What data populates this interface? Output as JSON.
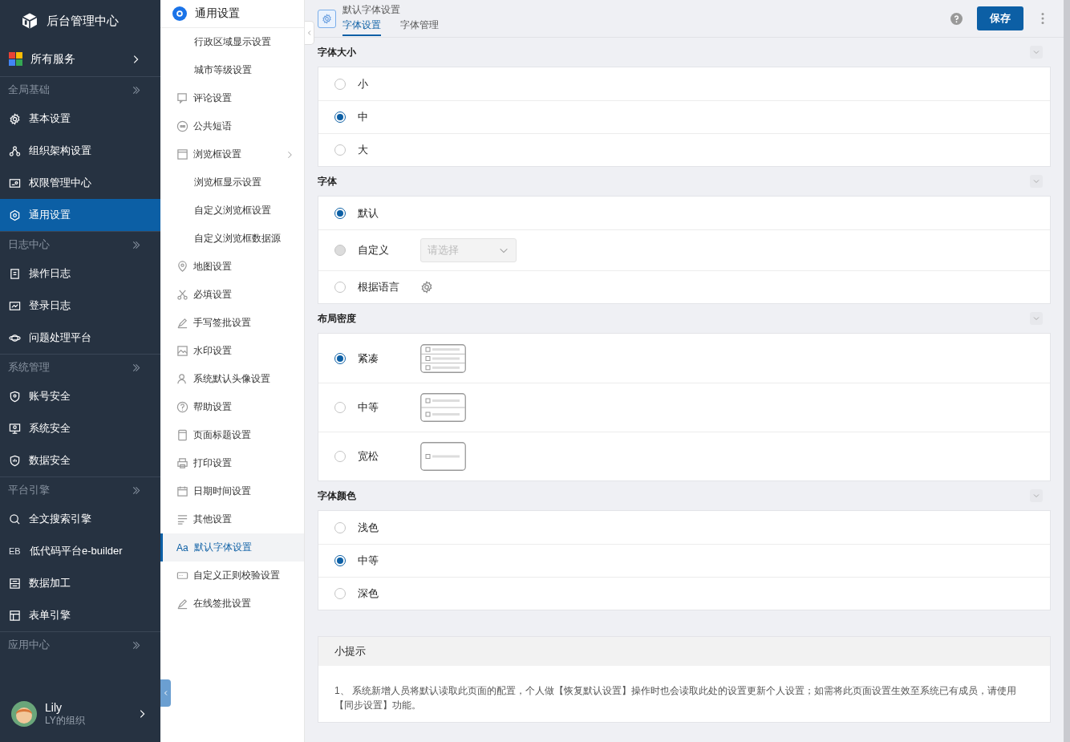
{
  "app": {
    "title": "后台管理中心"
  },
  "all_services": {
    "label": "所有服务"
  },
  "sidebar": {
    "groups": [
      {
        "label": "全局基础",
        "items": [
          {
            "label": "基本设置",
            "selected": false
          },
          {
            "label": "组织架构设置",
            "selected": false
          },
          {
            "label": "权限管理中心",
            "selected": false
          },
          {
            "label": "通用设置",
            "selected": true
          }
        ]
      },
      {
        "label": "日志中心",
        "items": [
          {
            "label": "操作日志",
            "selected": false
          },
          {
            "label": "登录日志",
            "selected": false
          },
          {
            "label": "问题处理平台",
            "selected": false
          }
        ]
      },
      {
        "label": "系统管理",
        "items": [
          {
            "label": "账号安全",
            "selected": false
          },
          {
            "label": "系统安全",
            "selected": false
          },
          {
            "label": "数据安全",
            "selected": false
          }
        ]
      },
      {
        "label": "平台引擎",
        "items": [
          {
            "label": "全文搜索引擎",
            "selected": false
          },
          {
            "label": "低代码平台e-builder",
            "selected": false,
            "badge": "EB"
          },
          {
            "label": "数据加工",
            "selected": false
          },
          {
            "label": "表单引擎",
            "selected": false
          }
        ]
      },
      {
        "label": "应用中心"
      }
    ]
  },
  "user": {
    "name": "Lily",
    "org": "LY的组织"
  },
  "submenu": {
    "title": "通用设置",
    "items": [
      {
        "label": "行政区域显示设置",
        "kind": "sub",
        "selected": false
      },
      {
        "label": "城市等级设置",
        "kind": "sub",
        "selected": false
      },
      {
        "label": "评论设置",
        "kind": "entry",
        "selected": false
      },
      {
        "label": "公共短语",
        "kind": "entry",
        "selected": false
      },
      {
        "label": "浏览框设置",
        "kind": "entry",
        "selected": false,
        "children": [
          {
            "label": "浏览框显示设置",
            "kind": "sub",
            "selected": false
          },
          {
            "label": "自定义浏览框设置",
            "kind": "sub",
            "selected": false
          },
          {
            "label": "自定义浏览框数据源",
            "kind": "sub",
            "selected": false
          }
        ]
      },
      {
        "label": "地图设置",
        "kind": "entry",
        "selected": false
      },
      {
        "label": "必填设置",
        "kind": "entry",
        "selected": false
      },
      {
        "label": "手写签批设置",
        "kind": "entry",
        "selected": false
      },
      {
        "label": "水印设置",
        "kind": "entry",
        "selected": false
      },
      {
        "label": "系统默认头像设置",
        "kind": "entry",
        "selected": false
      },
      {
        "label": "帮助设置",
        "kind": "entry",
        "selected": false
      },
      {
        "label": "页面标题设置",
        "kind": "entry",
        "selected": false
      },
      {
        "label": "打印设置",
        "kind": "entry",
        "selected": false
      },
      {
        "label": "日期时间设置",
        "kind": "entry",
        "selected": false
      },
      {
        "label": "其他设置",
        "kind": "entry",
        "selected": false
      },
      {
        "label": "默认字体设置",
        "kind": "font",
        "icon_text": "Aa",
        "selected": true
      },
      {
        "label": "自定义正则校验设置",
        "kind": "entry",
        "selected": false
      },
      {
        "label": "在线签批设置",
        "kind": "entry",
        "selected": false
      }
    ]
  },
  "page": {
    "title": "默认字体设置",
    "tabs": [
      {
        "label": "字体设置",
        "selected": true
      },
      {
        "label": "字体管理",
        "selected": false
      }
    ],
    "save_button": "保存"
  },
  "sections": [
    {
      "title": "字体大小",
      "options": [
        {
          "label": "小",
          "selected": false,
          "kind": "plain"
        },
        {
          "label": "中",
          "selected": true,
          "kind": "plain"
        },
        {
          "label": "大",
          "selected": false,
          "kind": "plain"
        }
      ]
    },
    {
      "title": "字体",
      "options": [
        {
          "label": "默认",
          "selected": true,
          "kind": "plain"
        },
        {
          "label": "自定义",
          "selected": false,
          "kind": "select",
          "disabled": true,
          "placeholder": "请选择"
        },
        {
          "label": "根据语言",
          "selected": false,
          "kind": "gear"
        }
      ]
    },
    {
      "title": "布局密度",
      "options": [
        {
          "label": "紧凑",
          "selected": true,
          "kind": "compact"
        },
        {
          "label": "中等",
          "selected": false,
          "kind": "medium"
        },
        {
          "label": "宽松",
          "selected": false,
          "kind": "loose"
        }
      ]
    },
    {
      "title": "字体颜色",
      "options": [
        {
          "label": "浅色",
          "selected": false,
          "kind": "plain"
        },
        {
          "label": "中等",
          "selected": true,
          "kind": "plain"
        },
        {
          "label": "深色",
          "selected": false,
          "kind": "plain"
        }
      ]
    }
  ],
  "tip": {
    "title": "小提示",
    "text": "1、 系统新增人员将默认读取此页面的配置，个人做【恢复默认设置】操作时也会读取此处的设置更新个人设置；如需将此页面设置生效至系统已有成员，请使用【同步设置】功能。"
  }
}
